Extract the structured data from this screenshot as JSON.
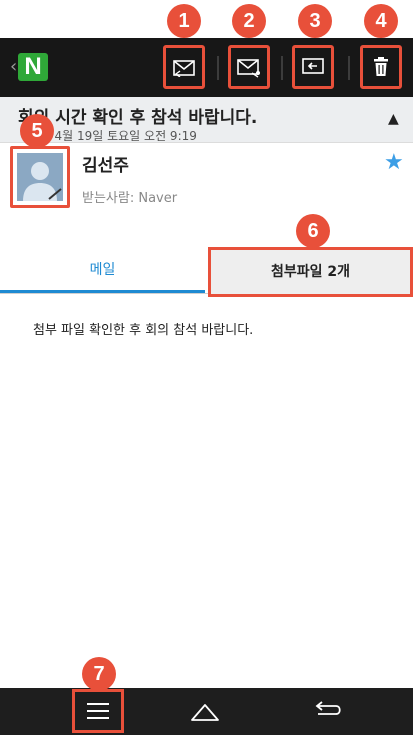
{
  "app": {
    "logo_letter": "N",
    "brand_color": "#2fa838",
    "accent_color": "#e8503a"
  },
  "toolbar": {
    "buttons": [
      {
        "icon": "reply-mail-icon",
        "callout": "1"
      },
      {
        "icon": "reply-all-mail-icon",
        "callout": "2"
      },
      {
        "icon": "forward-mail-icon",
        "callout": "3"
      },
      {
        "icon": "trash-icon",
        "callout": "4"
      }
    ]
  },
  "message": {
    "subject": "회의 시간 확인 후 참석 바랍니다.",
    "date": "4년 4월 19일 토요일 오전 9:19",
    "sender_name": "김선주",
    "recipients": "받는사람: Naver",
    "body": "첨부 파일 확인한 후 회의 참석 바랍니다."
  },
  "callouts": {
    "avatar": "5",
    "attachments_tab": "6",
    "menu": "7"
  },
  "tabs": {
    "mail": "메일",
    "attachments": "첨부파일 2개"
  },
  "navbar": {
    "icons": [
      "menu-icon",
      "home-icon",
      "back-icon"
    ]
  }
}
